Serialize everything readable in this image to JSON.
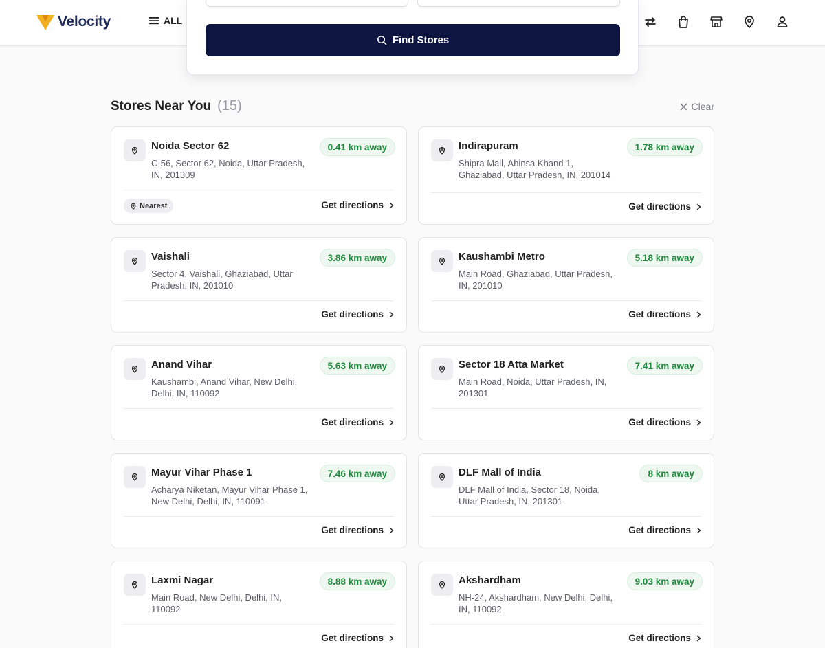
{
  "brand": {
    "name": "Velocity"
  },
  "header": {
    "menu_label": "ALL",
    "icons": [
      "swap-icon",
      "bag-icon",
      "store-icon",
      "location-pin-icon",
      "user-icon"
    ]
  },
  "search_panel": {
    "button_label": "Find Stores"
  },
  "results": {
    "title": "Stores Near You",
    "count": "(15)",
    "clear_label": "Clear"
  },
  "stores": [
    {
      "name": "Noida Sector 62",
      "address": "C-56, Sector 62, Noida, Uttar Pradesh, IN, 201309",
      "distance": "0.41 km away",
      "badge": "Nearest",
      "directions": "Get directions"
    },
    {
      "name": "Indirapuram",
      "address": "Shipra Mall, Ahinsa Khand 1, Ghaziabad, Uttar Pradesh, IN, 201014",
      "distance": "1.78 km away",
      "directions": "Get directions"
    },
    {
      "name": "Vaishali",
      "address": "Sector 4, Vaishali, Ghaziabad, Uttar Pradesh, IN, 201010",
      "distance": "3.86 km away",
      "directions": "Get directions"
    },
    {
      "name": "Kaushambi Metro",
      "address": "Main Road, Ghaziabad, Uttar Pradesh, IN, 201010",
      "distance": "5.18 km away",
      "directions": "Get directions"
    },
    {
      "name": "Anand Vihar",
      "address": "Kaushambi, Anand Vihar, New Delhi, Delhi, IN, 110092",
      "distance": "5.63 km away",
      "directions": "Get directions"
    },
    {
      "name": "Sector 18 Atta Market",
      "address": "Main Road, Noida, Uttar Pradesh, IN, 201301",
      "distance": "7.41 km away",
      "directions": "Get directions"
    },
    {
      "name": "Mayur Vihar Phase 1",
      "address": "Acharya Niketan, Mayur Vihar Phase 1, New Delhi, Delhi, IN, 110091",
      "distance": "7.46 km away",
      "directions": "Get directions"
    },
    {
      "name": "DLF Mall of India",
      "address": "DLF Mall of India, Sector 18, Noida, Uttar Pradesh, IN, 201301",
      "distance": "8 km away",
      "directions": "Get directions"
    },
    {
      "name": "Laxmi Nagar",
      "address": "Main Road, New Delhi, Delhi, IN, 110092",
      "distance": "8.88 km away",
      "directions": "Get directions"
    },
    {
      "name": "Akshardham",
      "address": "NH-24, Akshardham, New Delhi, Delhi, IN, 110092",
      "distance": "9.03 km away",
      "directions": "Get directions"
    }
  ],
  "colors": {
    "primary": "#0d1540",
    "distance_text": "#1f8a3d",
    "distance_bg": "#eef8f0",
    "logo_accent": "#f2b01e"
  }
}
